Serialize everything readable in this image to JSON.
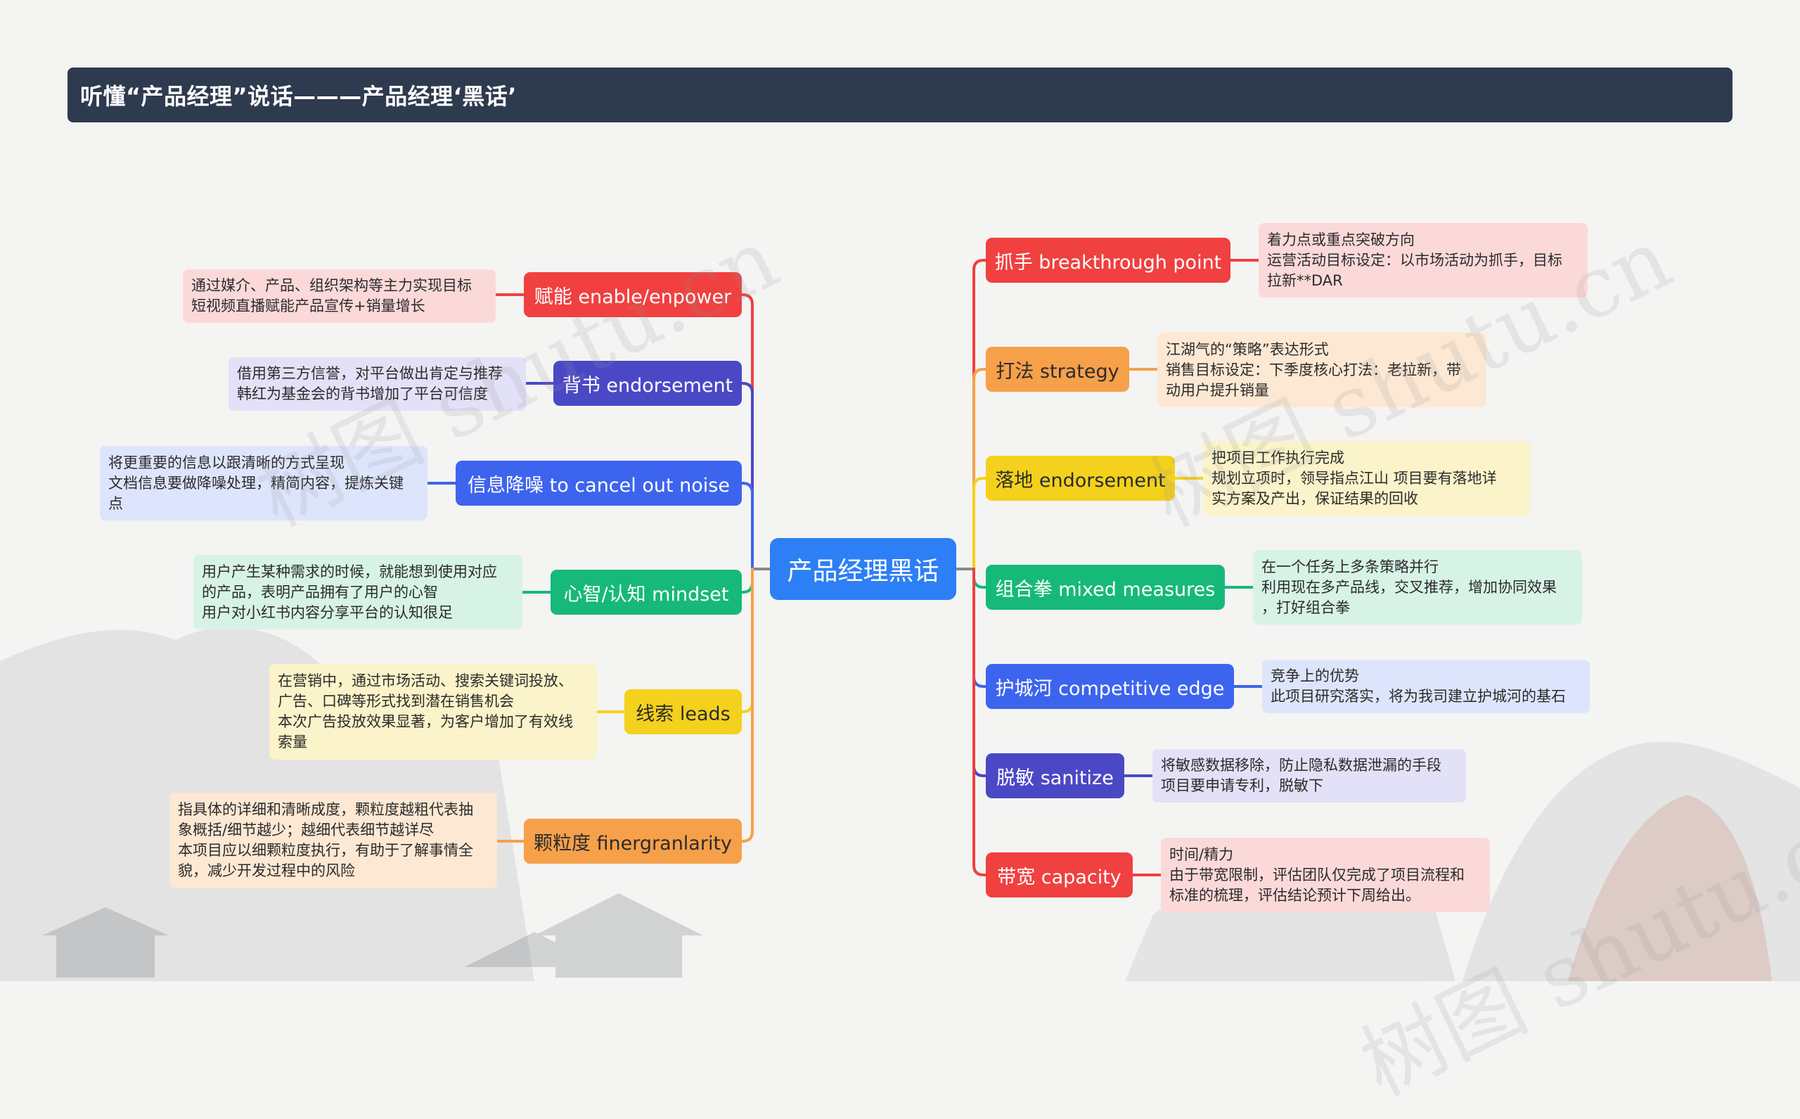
{
  "title": "听懂“产品经理”说话———产品经理‘黑话’",
  "center": {
    "label": "产品经理黑话",
    "color": "#2d7ff5"
  },
  "watermark": "树图 shutu.cn",
  "left_branches": [
    {
      "key": "empower",
      "label": "赋能 enable/enpower",
      "color": "#f04040",
      "note_bg": "#fcd9d9",
      "note": [
        "通过媒介、产品、组织架构等主力实现目标",
        "短视频直播赋能产品宣传+销量增长"
      ]
    },
    {
      "key": "endorse",
      "label": "背书 endorsement",
      "color": "#4b48c6",
      "note_bg": "#e2e1f7",
      "note": [
        "借用第三方信誉，对平台做出肯定与推荐",
        "韩红为基金会的背书增加了平台可信度"
      ]
    },
    {
      "key": "noise",
      "label": "信息降噪 to cancel out noise",
      "color": "#3d64ee",
      "note_bg": "#dde5fc",
      "note": [
        "将更重要的信息以跟清晰的方式呈现",
        "文档信息要做降噪处理，精简内容，提炼关键",
        "点"
      ]
    },
    {
      "key": "mindset",
      "label": "心智/认知 mindset",
      "color": "#16b979",
      "note_bg": "#d6f3e6",
      "note": [
        "用户产生某种需求的时候，就能想到使用对应",
        "的产品，表明产品拥有了用户的心智",
        "用户对小红书内容分享平台的认知很足"
      ]
    },
    {
      "key": "leads",
      "label": "线索 leads",
      "color": "#f4d11c",
      "note_bg": "#fbf3c9",
      "note": [
        "在营销中，通过市场活动、搜索关键词投放、",
        "广告、口碑等形式找到潜在销售机会",
        "本次广告投放效果显著，为客户增加了有效线",
        "索量"
      ]
    },
    {
      "key": "granular",
      "label": "颗粒度 finergranlarity",
      "color": "#f6a04a",
      "note_bg": "#fde8d3",
      "note": [
        "指具体的详细和清晰成度，颗粒度越粗代表抽",
        "象概括/细节越少；越细代表细节越详尽",
        "本项目应以细颗粒度执行，有助于了解事情全",
        "貌，减少开发过程中的风险"
      ]
    }
  ],
  "right_branches": [
    {
      "key": "breakthrough",
      "label": "抓手 breakthrough point",
      "color": "#f04040",
      "note_bg": "#fcd9d9",
      "note": [
        "着力点或重点突破方向",
        "运营活动目标设定：以市场活动为抓手，目标",
        "拉新**DAR"
      ]
    },
    {
      "key": "strategy",
      "label": "打法 strategy",
      "color": "#f6a04a",
      "note_bg": "#fde8d3",
      "note": [
        "江湖气的“策略”表达形式",
        "销售目标设定：下季度核心打法：老拉新，带",
        "动用户提升销量"
      ]
    },
    {
      "key": "landing",
      "label": "落地 endorsement",
      "color": "#f4d11c",
      "note_bg": "#fbf3c9",
      "note": [
        "把项目工作执行完成",
        "规划立项时，领导指点江山 项目要有落地详",
        "实方案及产出，保证结果的回收"
      ]
    },
    {
      "key": "combo",
      "label": "组合拳 mixed measures",
      "color": "#16b979",
      "note_bg": "#d6f3e6",
      "note": [
        "在一个任务上多条策略并行",
        "利用现在多产品线，交叉推荐，增加协同效果",
        "，打好组合拳"
      ]
    },
    {
      "key": "moat",
      "label": "护城河 competitive edge",
      "color": "#3d64ee",
      "note_bg": "#dde5fc",
      "note": [
        "竞争上的优势",
        "此项目研究落实，将为我司建立护城河的基石"
      ]
    },
    {
      "key": "sanitize",
      "label": "脱敏 sanitize",
      "color": "#4b48c6",
      "note_bg": "#e2e1f7",
      "note": [
        "将敏感数据移除，防止隐私数据泄漏的手段",
        "项目要申请专利，脱敏下"
      ]
    },
    {
      "key": "capacity",
      "label": "带宽 capacity",
      "color": "#f04040",
      "note_bg": "#fcd9d9",
      "note": [
        "时间/精力",
        "由于带宽限制，评估团队仅完成了项目流程和",
        "标准的梳理，评估结论预计下周给出。"
      ]
    }
  ]
}
